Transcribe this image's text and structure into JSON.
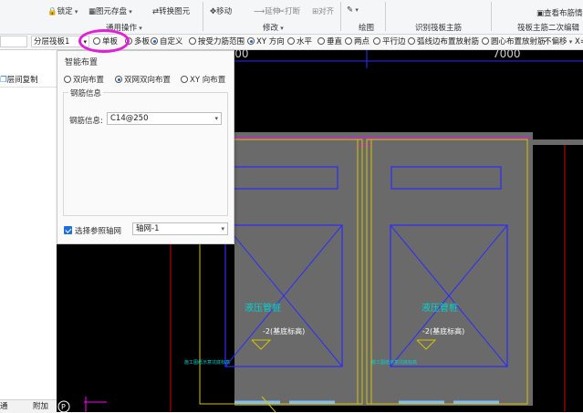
{
  "ribbon": {
    "items": [
      "锁定",
      "图元存盘",
      "转换图元",
      "移动",
      "延伸",
      "打断",
      "对齐"
    ],
    "groups": [
      "通用操作",
      "修改",
      "绘图",
      "识别筏板主筋",
      "筏板主筋二次编辑"
    ],
    "view_label": "查看布筋情况"
  },
  "toolbar": {
    "layer_combo": "分层筏板1",
    "radios": [
      {
        "label": "单板",
        "checked": false
      },
      {
        "label": "多板",
        "checked": false
      },
      {
        "label": "自定义",
        "checked": true
      },
      {
        "label": "按受力筋范围",
        "checked": false
      },
      {
        "label": "XY 方向",
        "checked": true
      },
      {
        "label": "水平",
        "checked": false
      },
      {
        "label": "垂直",
        "checked": false
      },
      {
        "label": "两点",
        "checked": false
      },
      {
        "label": "平行边",
        "checked": false
      },
      {
        "label": "弧线边布置放射筋",
        "checked": false
      },
      {
        "label": "圆心布置放射筋",
        "checked": false
      }
    ],
    "offset_combo": "不偏移",
    "offset_suffix": "X="
  },
  "left_panel": {
    "layer_copy": "层间复制",
    "bottom_left": "通",
    "bottom_right": "附加"
  },
  "dialog": {
    "title": "智能布置",
    "layout_options": [
      {
        "label": "双向布置",
        "checked": false
      },
      {
        "label": "双网双向布置",
        "checked": true
      },
      {
        "label": "XY 向布置",
        "checked": false
      }
    ],
    "section_title": "钢筋信息",
    "rebar_label": "钢筋信息:",
    "rebar_value": "C14@250",
    "axis_check_label": "选择参照轴网",
    "axis_value": "轴网-1"
  },
  "canvas": {
    "dim_top_left": "7000",
    "dim_top_right": "7000",
    "room_label_left": "液压管桩",
    "room_label_right": "液压管桩",
    "elev_left": "-2(基底标高)",
    "elev_right": "-2(基底标高)",
    "note_left": "施工图纸示意坑底标高",
    "note_right": "施工图纸示意坑底标高",
    "bottom_badge": "P"
  },
  "colors": {
    "cad_background": "#000000",
    "slab_fill": "#6a6a6a",
    "cad_blue": "#2b2bff",
    "cad_magenta": "#ff00ff",
    "cad_yellow": "#d4c400",
    "cad_cyan": "#00d4d4",
    "cad_red": "#d40000",
    "highlight_circle": "#e01fd6"
  }
}
